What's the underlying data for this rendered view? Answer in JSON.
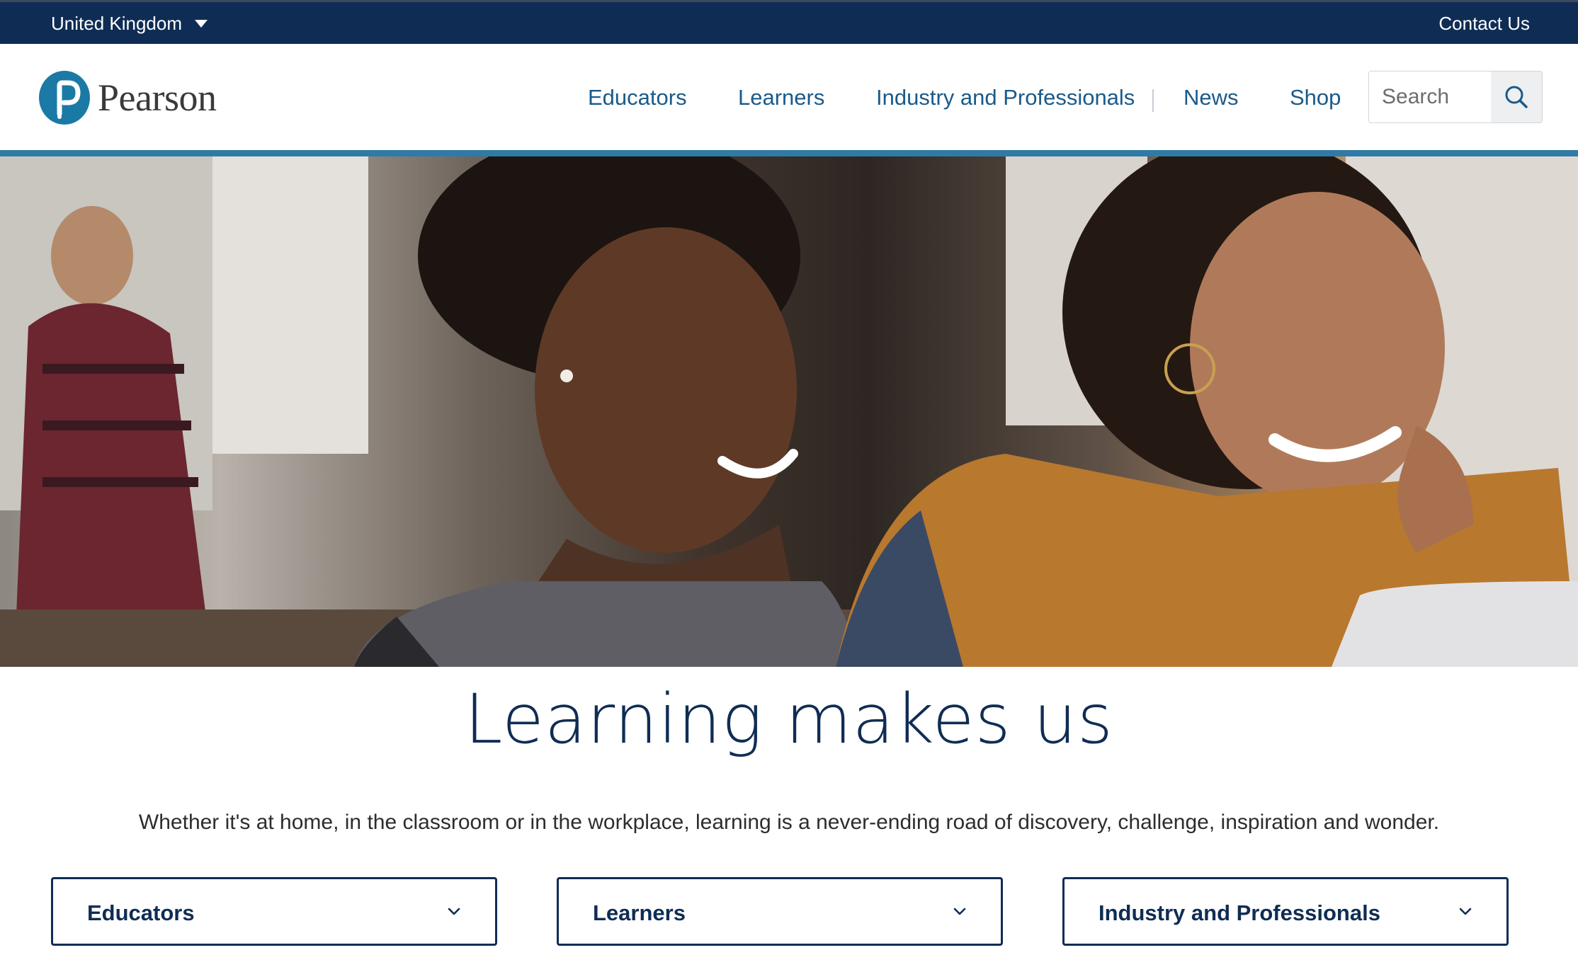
{
  "topbar": {
    "region": "United Kingdom",
    "contact": "Contact Us"
  },
  "header": {
    "logo_text": "Pearson",
    "nav": [
      {
        "label": "Educators"
      },
      {
        "label": "Learners"
      },
      {
        "label": "Industry and Professionals"
      },
      {
        "label": "News"
      },
      {
        "label": "Shop"
      }
    ],
    "search_placeholder": "Search"
  },
  "hero": {
    "headline": "Learning makes us",
    "subtext": "Whether it's at home, in the classroom or in the workplace, learning is a never-ending road of discovery, challenge, inspiration and wonder."
  },
  "dropdowns": [
    {
      "label": "Educators"
    },
    {
      "label": "Learners"
    },
    {
      "label": "Industry and Professionals"
    }
  ],
  "colors": {
    "navy": "#0f2d54",
    "nav_link": "#1a5a8a",
    "accent_rule": "#2f7ba6",
    "logo_blue": "#1a7aa5"
  },
  "icons": [
    "caret-down-icon",
    "pearson-logo-icon",
    "search-icon",
    "chevron-down-icon"
  ]
}
